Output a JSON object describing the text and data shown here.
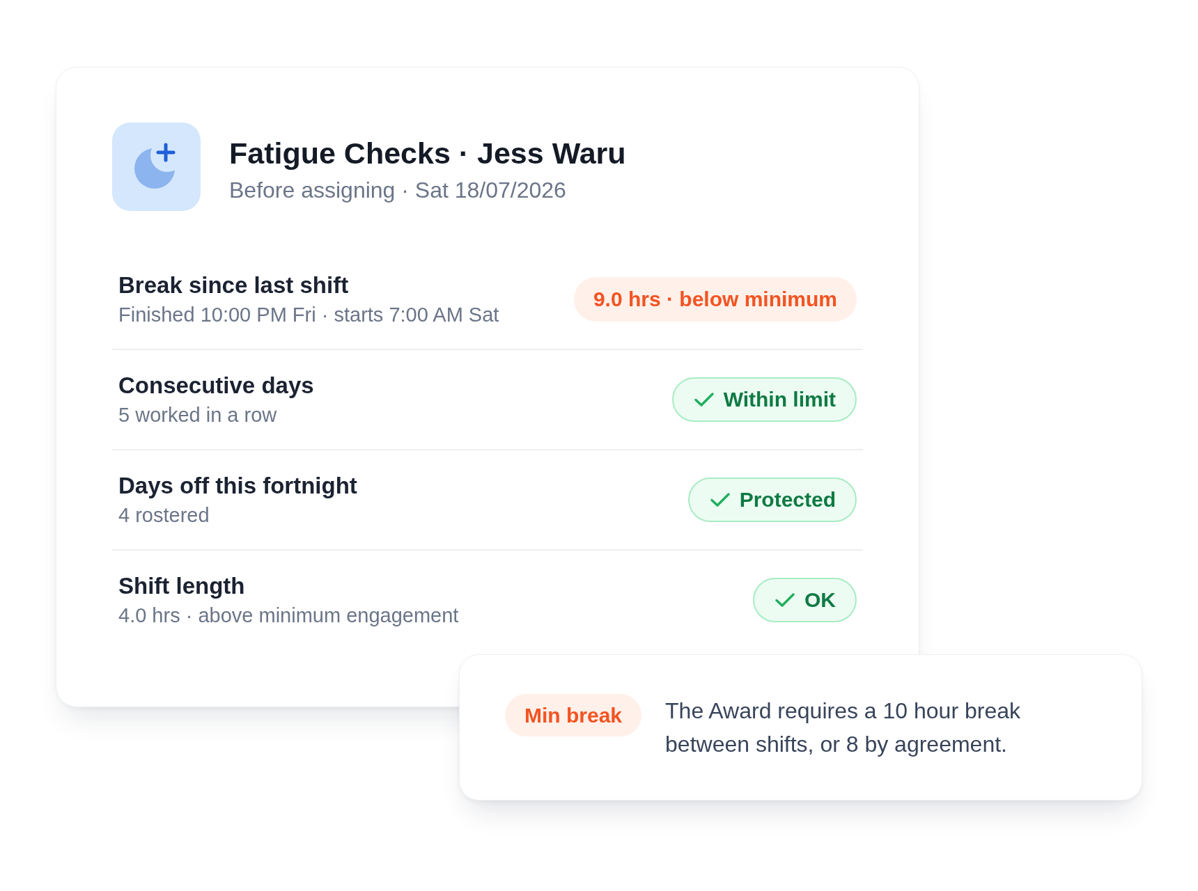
{
  "header": {
    "title": "Fatigue Checks · Jess Waru",
    "subtitle": "Before assigning · Sat 18/07/2026"
  },
  "checks": [
    {
      "title": "Break since last shift",
      "detail": "Finished 10:00 PM Fri · starts 7:00 AM Sat",
      "status": {
        "kind": "warning",
        "label": "9.0 hrs · below minimum"
      }
    },
    {
      "title": "Consecutive days",
      "detail": "5 worked in a row",
      "status": {
        "kind": "ok",
        "label": "Within limit"
      }
    },
    {
      "title": "Days off this fortnight",
      "detail": "4 rostered",
      "status": {
        "kind": "ok",
        "label": "Protected"
      }
    },
    {
      "title": "Shift length",
      "detail": "4.0 hrs · above minimum engagement",
      "status": {
        "kind": "ok",
        "label": "OK"
      }
    }
  ],
  "note": {
    "tag": {
      "kind": "warning",
      "label": "Min break"
    },
    "text": "The Award requires a 10 hour break between shifts, or 8 by agreement."
  }
}
